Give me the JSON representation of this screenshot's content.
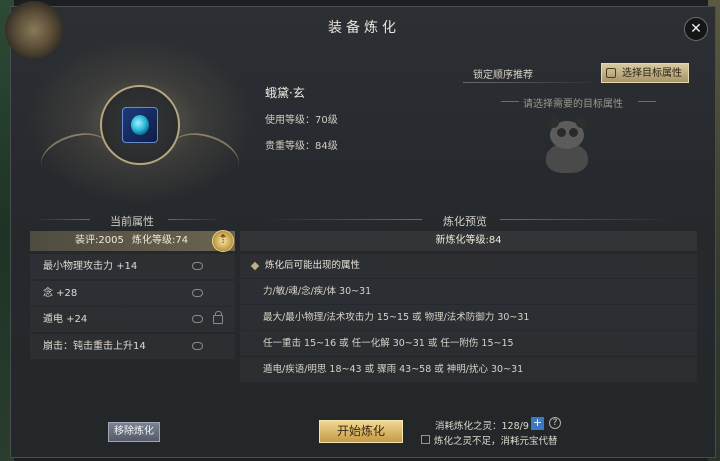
{
  "window": {
    "title": "装备炼化"
  },
  "item": {
    "name": "蛾黛·玄",
    "use_level": "使用等级：70级",
    "value_level": "贵重等级：84级"
  },
  "recommend": {
    "label": "锁定顺序推荐",
    "select_button": "选择目标属性",
    "hint": "请选择需要的目标属性"
  },
  "current": {
    "title": "当前属性",
    "score": "装评:2005",
    "level": "炼化等级:74",
    "attributes": [
      "最小物理攻击力 +14",
      "念 +28",
      "遁电 +24",
      "崩击：钝击重击上升14"
    ]
  },
  "preview": {
    "title": "炼化预览",
    "new_level": "新炼化等级:84",
    "rows": [
      "炼化后可能出现的属性",
      "力/敏/魂/念/疾/体 30~31",
      "最大/最小物理/法术攻击力 15~15 或 物理/法术防御力 30~31",
      "任一重击 15~16 或 任一化解 30~31 或 任一附伤 15~15",
      "遁电/疾语/明思 18~43 或 骤雨 43~58 或 神明/扰心 30~31"
    ]
  },
  "footer": {
    "remove_button": "移除炼化",
    "start_button": "开始炼化",
    "cost": "消耗炼化之灵：128/9",
    "plus": "+",
    "help": "?",
    "checkbox_label": "炼化之灵不足，消耗元宝代替"
  },
  "icons": {
    "close": "✕"
  }
}
